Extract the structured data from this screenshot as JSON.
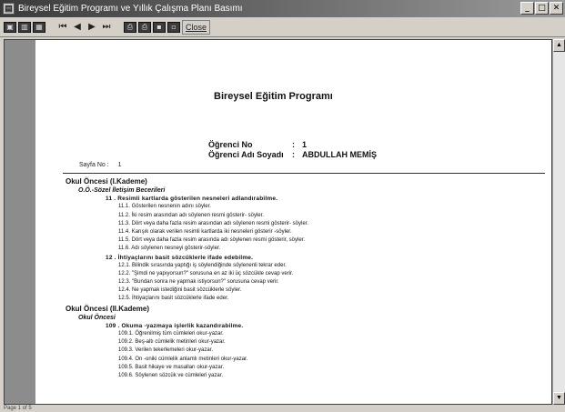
{
  "window": {
    "title": "Bireysel Eğitim Programı ve Yıllık Çalışma Planı Basımı",
    "buttons": {
      "minimize": "_",
      "maximize": "□",
      "close": "✕"
    }
  },
  "toolbar": {
    "nav": {
      "first": "⏮",
      "prev": "◀",
      "next": "▶",
      "last": "⏭"
    },
    "close_label": "Close"
  },
  "document": {
    "title": "Bireysel Eğitim Programı",
    "page_label": "Sayfa No :",
    "page_number": "1",
    "student_no_label": "Öğrenci No",
    "student_no_sep": ":",
    "student_no_value": "1",
    "student_name_label": "Öğrenci Adı Soyadı",
    "student_name_sep": ":",
    "student_name_value": "ABDULLAH MEMİŞ",
    "lines": [
      {
        "type": "section",
        "text": "Okul Öncesi (I.Kademe)"
      },
      {
        "type": "sub",
        "text": "O.Ö.-Sözel İletişim Becerileri"
      },
      {
        "type": "goal",
        "text": "11 .  Resimli kartlarda gösterilen nesneleri adlandırabilme."
      },
      {
        "type": "item",
        "text": "11.1. Gösterilen nesnenin adını söyler."
      },
      {
        "type": "item",
        "text": "11.2. İki resim arasından adı söylenen resmi gösterir- söyler."
      },
      {
        "type": "item",
        "text": "11.3. Dört veya daha fazla resim arasından adı söylenen resmi gösterir- söyler."
      },
      {
        "type": "item",
        "text": "11.4. Karışık olarak verilen resimli kartlarda iki nesneleri gösterir -söyler."
      },
      {
        "type": "item",
        "text": "11.5. Dört veya daha fazla resim arasında adı söylenen resmi gösterir, söyler."
      },
      {
        "type": "item",
        "text": "11.6. Adı söylenen nesneyi gösterir-söyler."
      },
      {
        "type": "goal",
        "text": "12 .  İhtiyaçlarını basit sözcüklerle ifade edebilme."
      },
      {
        "type": "item",
        "text": "12.1. Bilindik sırasında yaptığı iş söylendiğinde söylenenli tekrar eder."
      },
      {
        "type": "item",
        "text": "12.2. \"Şimdi ne yapıyorsun?\" sorusuna en az iki üç sözcükle cevap verir."
      },
      {
        "type": "item",
        "text": "12.3. \"Bundan sonra ne yapmak istiyorsun?\" sorusuna cevap verir."
      },
      {
        "type": "item",
        "text": "12.4. Ne yapmak istediğini basit sözcüklerle söyler."
      },
      {
        "type": "item",
        "text": "12.5. İhtiyaçlarını basit sözcüklerle ifade eder."
      },
      {
        "type": "section",
        "text": "Okul Öncesi (II.Kademe)"
      },
      {
        "type": "sub",
        "text": "Okul Öncesi"
      },
      {
        "type": "goal",
        "text": "109 .  Okuma -yazmaya işlerlik kazandırabilme."
      },
      {
        "type": "item",
        "text": "109.1. Öğrenilmiş tüm cümleleri okur-yazar."
      },
      {
        "type": "item",
        "text": "109.2. Beş-altı cümlelik metinleri okur-yazar."
      },
      {
        "type": "item",
        "text": "109.3. Verilen tekerlemeleri okur-yazar."
      },
      {
        "type": "item",
        "text": "109.4. On -oniki cümlelik anlamlı metinleri okur-yazar."
      },
      {
        "type": "item",
        "text": "109.5. Basit hikaye ve masalları okur-yazar."
      },
      {
        "type": "item",
        "text": "109.6. Söylenen sözcük ve cümleleri yazar."
      }
    ]
  },
  "statusbar": {
    "text": "Page 1 of 5"
  }
}
